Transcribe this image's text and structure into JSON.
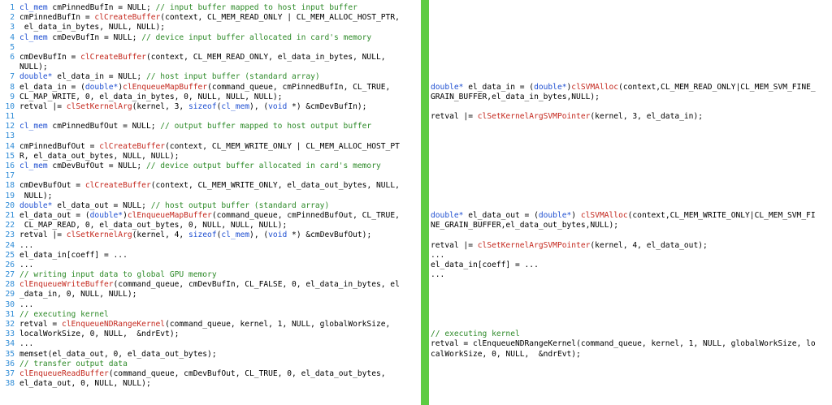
{
  "colors": {
    "keyword": "#1f4fd1",
    "function": "#c4281e",
    "comment": "#2d8a28",
    "line_number": "#2d8bd6",
    "divider": "#5dcc43"
  },
  "left_lines": [
    [
      "1",
      [
        [
          "kw",
          "cl_mem"
        ],
        [
          "plain",
          " cmPinnedBufIn = NULL; "
        ],
        [
          "cm",
          "// input buffer mapped to host input buffer"
        ]
      ]
    ],
    [
      "2",
      [
        [
          "plain",
          "cmPinnedBufIn = "
        ],
        [
          "fn",
          "clCreateBuffer"
        ],
        [
          "plain",
          "(context, CL_MEM_READ_ONLY | CL_MEM_ALLOC_HOST_PTR,"
        ]
      ]
    ],
    [
      "3",
      [
        [
          "plain",
          " el_data_in_bytes, NULL, NULL);"
        ]
      ]
    ],
    [
      "4",
      [
        [
          "kw",
          "cl_mem"
        ],
        [
          "plain",
          " cmDevBufIn = NULL; "
        ],
        [
          "cm",
          "// device input buffer allocated in card's memory"
        ]
      ]
    ],
    [
      "5",
      []
    ],
    [
      "6",
      [
        [
          "plain",
          "cmDevBufIn = "
        ],
        [
          "fn",
          "clCreateBuffer"
        ],
        [
          "plain",
          "(context, CL_MEM_READ_ONLY, el_data_in_bytes, NULL,"
        ]
      ]
    ],
    [
      "",
      [
        [
          "plain",
          "NULL);"
        ]
      ]
    ],
    [
      "7",
      [
        [
          "kw",
          "double*"
        ],
        [
          "plain",
          " el_data_in = NULL; "
        ],
        [
          "cm",
          "// host input buffer (standard array)"
        ]
      ]
    ],
    [
      "8",
      [
        [
          "plain",
          "el_data_in = ("
        ],
        [
          "kw",
          "double*"
        ],
        [
          "plain",
          ")"
        ],
        [
          "fn",
          "clEnqueueMapBuffer"
        ],
        [
          "plain",
          "(command_queue, cmPinnedBufIn, CL_TRUE,"
        ]
      ]
    ],
    [
      "9",
      [
        [
          "plain",
          "CL_MAP_WRITE, 0, el_data_in_bytes, 0, NULL, NULL, NULL);"
        ]
      ]
    ],
    [
      "10",
      [
        [
          "plain",
          "retval |= "
        ],
        [
          "fn",
          "clSetKernelArg"
        ],
        [
          "plain",
          "(kernel, 3, "
        ],
        [
          "kw",
          "sizeof"
        ],
        [
          "plain",
          "("
        ],
        [
          "kw",
          "cl_mem"
        ],
        [
          "plain",
          "), ("
        ],
        [
          "kw",
          "void"
        ],
        [
          "plain",
          " *) &cmDevBufIn);"
        ]
      ]
    ],
    [
      "11",
      []
    ],
    [
      "12",
      [
        [
          "kw",
          "cl_mem"
        ],
        [
          "plain",
          " cmPinnedBufOut = NULL; "
        ],
        [
          "cm",
          "// output buffer mapped to host output buffer"
        ]
      ]
    ],
    [
      "13",
      []
    ],
    [
      "14",
      [
        [
          "plain",
          "cmPinnedBufOut = "
        ],
        [
          "fn",
          "clCreateBuffer"
        ],
        [
          "plain",
          "(context, CL_MEM_WRITE_ONLY | CL_MEM_ALLOC_HOST_PT"
        ]
      ]
    ],
    [
      "15",
      [
        [
          "plain",
          "R, el_data_out_bytes, NULL, NULL);"
        ]
      ]
    ],
    [
      "16",
      [
        [
          "kw",
          "cl_mem"
        ],
        [
          "plain",
          " cmDevBufOut = NULL; "
        ],
        [
          "cm",
          "// device output buffer allocated in card's memory"
        ]
      ]
    ],
    [
      "17",
      []
    ],
    [
      "18",
      [
        [
          "plain",
          "cmDevBufOut = "
        ],
        [
          "fn",
          "clCreateBuffer"
        ],
        [
          "plain",
          "(context, CL_MEM_WRITE_ONLY, el_data_out_bytes, NULL,"
        ]
      ]
    ],
    [
      "19",
      [
        [
          "plain",
          " NULL);"
        ]
      ]
    ],
    [
      "20",
      [
        [
          "kw",
          "double*"
        ],
        [
          "plain",
          " el_data_out = NULL; "
        ],
        [
          "cm",
          "// host output buffer (standard array)"
        ]
      ]
    ],
    [
      "21",
      [
        [
          "plain",
          "el_data_out = ("
        ],
        [
          "kw",
          "double*"
        ],
        [
          "plain",
          ")"
        ],
        [
          "fn",
          "clEnqueueMapBuffer"
        ],
        [
          "plain",
          "(command_queue, cmPinnedBufOut, CL_TRUE,"
        ]
      ]
    ],
    [
      "22",
      [
        [
          "plain",
          " CL_MAP_READ, 0, el_data_out_bytes, 0, NULL, NULL, NULL);"
        ]
      ]
    ],
    [
      "23",
      [
        [
          "plain",
          "retval |= "
        ],
        [
          "fn",
          "clSetKernelArg"
        ],
        [
          "plain",
          "(kernel, 4, "
        ],
        [
          "kw",
          "sizeof"
        ],
        [
          "plain",
          "("
        ],
        [
          "kw",
          "cl_mem"
        ],
        [
          "plain",
          "), ("
        ],
        [
          "kw",
          "void"
        ],
        [
          "plain",
          " *) &cmDevBufOut);"
        ]
      ]
    ],
    [
      "24",
      [
        [
          "plain",
          "..."
        ]
      ]
    ],
    [
      "25",
      [
        [
          "plain",
          "el_data_in[coeff] = ..."
        ]
      ]
    ],
    [
      "26",
      [
        [
          "plain",
          "..."
        ]
      ]
    ],
    [
      "27",
      [
        [
          "cm",
          "// writing input data to global GPU memory"
        ]
      ]
    ],
    [
      "28",
      [
        [
          "fn",
          "clEnqueueWriteBuffer"
        ],
        [
          "plain",
          "(command_queue, cmDevBufIn, CL_FALSE, 0, el_data_in_bytes, el"
        ]
      ]
    ],
    [
      "29",
      [
        [
          "plain",
          "_data_in, 0, NULL, NULL);"
        ]
      ]
    ],
    [
      "30",
      [
        [
          "plain",
          "..."
        ]
      ]
    ],
    [
      "31",
      [
        [
          "cm",
          "// executing kernel"
        ]
      ]
    ],
    [
      "32",
      [
        [
          "plain",
          "retval = "
        ],
        [
          "fn",
          "clEnqueueNDRangeKernel"
        ],
        [
          "plain",
          "(command_queue, kernel, 1, NULL, globalWorkSize,"
        ]
      ]
    ],
    [
      "33",
      [
        [
          "plain",
          "localWorkSize, 0, NULL,  &ndrEvt);"
        ]
      ]
    ],
    [
      "34",
      [
        [
          "plain",
          "..."
        ]
      ]
    ],
    [
      "35",
      [
        [
          "plain",
          "memset(el_data_out, 0, el_data_out_bytes);"
        ]
      ]
    ],
    [
      "36",
      [
        [
          "cm",
          "// transfer output data"
        ]
      ]
    ],
    [
      "37",
      [
        [
          "fn",
          "clEnqueueReadBuffer"
        ],
        [
          "plain",
          "(command_queue, cmDevBufOut, CL_TRUE, 0, el_data_out_bytes,"
        ]
      ]
    ],
    [
      "38",
      [
        [
          "plain",
          "el_data_out, 0, NULL, NULL);"
        ]
      ]
    ]
  ],
  "right_lines": [
    [],
    [],
    [],
    [],
    [],
    [],
    [],
    [],
    [
      [
        "kw",
        "double*"
      ],
      [
        "plain",
        " el_data_in = ("
      ],
      [
        "kw",
        "double*"
      ],
      [
        "plain",
        ")"
      ],
      [
        "fn",
        "clSVMAlloc"
      ],
      [
        "plain",
        "(context,CL_MEM_READ_ONLY|CL_MEM_SVM_FINE_"
      ]
    ],
    [
      [
        "plain",
        "GRAIN_BUFFER,el_data_in_bytes,NULL);"
      ]
    ],
    [],
    [
      [
        "plain",
        "retval |= "
      ],
      [
        "fn",
        "clSetKernelArgSVMPointer"
      ],
      [
        "plain",
        "(kernel, 3, el_data_in);"
      ]
    ],
    [],
    [],
    [],
    [],
    [],
    [],
    [],
    [],
    [],
    [
      [
        "kw",
        "double*"
      ],
      [
        "plain",
        " el_data_out = ("
      ],
      [
        "kw",
        "double*"
      ],
      [
        "plain",
        ") "
      ],
      [
        "fn",
        "clSVMAlloc"
      ],
      [
        "plain",
        "(context,CL_MEM_WRITE_ONLY|CL_MEM_SVM_FI"
      ]
    ],
    [
      [
        "plain",
        "NE_GRAIN_BUFFER,el_data_out_bytes,NULL);"
      ]
    ],
    [],
    [
      [
        "plain",
        "retval |= "
      ],
      [
        "fn",
        "clSetKernelArgSVMPointer"
      ],
      [
        "plain",
        "(kernel, 4, el_data_out);"
      ]
    ],
    [
      [
        "plain",
        "..."
      ]
    ],
    [
      [
        "plain",
        "el_data_in[coeff] = ..."
      ]
    ],
    [
      [
        "plain",
        "..."
      ]
    ],
    [],
    [],
    [],
    [],
    [],
    [
      [
        "cm",
        "// executing kernel"
      ]
    ],
    [
      [
        "plain",
        "retval = "
      ],
      [
        "plain",
        "clEnqueueNDRangeKernel"
      ],
      [
        "plain",
        "(command_queue, kernel, 1, NULL, globalWorkSize, lo"
      ]
    ],
    [
      [
        "plain",
        "calWorkSize, 0, NULL,  &ndrEvt);"
      ]
    ]
  ]
}
